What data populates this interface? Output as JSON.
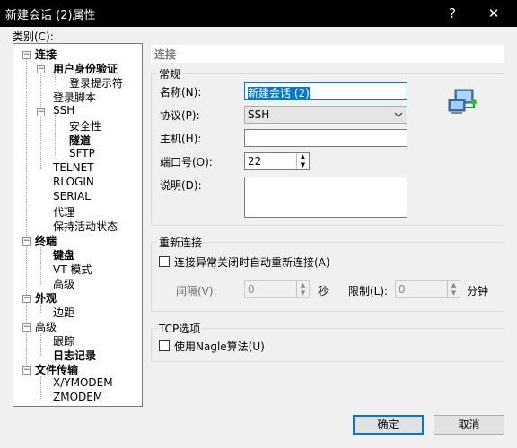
{
  "window": {
    "title": "新建会话 (2)属性",
    "help": "?",
    "close": "✕"
  },
  "category_label": "类别(C):",
  "tree": [
    {
      "label": "连接",
      "bold": true
    },
    {
      "label": "用户身份验证",
      "bold": true
    },
    {
      "label": "登录提示符"
    },
    {
      "label": "登录脚本"
    },
    {
      "label": "SSH"
    },
    {
      "label": "安全性"
    },
    {
      "label": "隧道",
      "bold": true
    },
    {
      "label": "SFTP"
    },
    {
      "label": "TELNET"
    },
    {
      "label": "RLOGIN"
    },
    {
      "label": "SERIAL"
    },
    {
      "label": "代理"
    },
    {
      "label": "保持活动状态"
    },
    {
      "label": "终端",
      "bold": true
    },
    {
      "label": "键盘",
      "bold": true
    },
    {
      "label": "VT 模式"
    },
    {
      "label": "高级"
    },
    {
      "label": "外观",
      "bold": true
    },
    {
      "label": "边距"
    },
    {
      "label": "高级"
    },
    {
      "label": "跟踪"
    },
    {
      "label": "日志记录",
      "bold": true
    },
    {
      "label": "文件传输",
      "bold": true
    },
    {
      "label": "X/YMODEM"
    },
    {
      "label": "ZMODEM"
    }
  ],
  "panel": {
    "header": "连接",
    "general": {
      "title": "常规",
      "name_label": "名称(N):",
      "name_value": "新建会话 (2)",
      "protocol_label": "协议(P):",
      "protocol_value": "SSH",
      "host_label": "主机(H):",
      "host_value": "",
      "port_label": "端口号(O):",
      "port_value": "22",
      "desc_label": "说明(D):",
      "desc_value": ""
    },
    "reconnect": {
      "title": "重新连接",
      "checkbox_label": "连接异常关闭时自动重新连接(A)",
      "interval_label": "间隔(V):",
      "interval_value": "0",
      "interval_unit": "秒",
      "limit_label": "限制(L):",
      "limit_value": "0",
      "limit_unit": "分钟"
    },
    "tcp": {
      "title": "TCP选项",
      "nagle_label": "使用Nagle算法(U)"
    }
  },
  "buttons": {
    "ok": "确定",
    "cancel": "取消"
  },
  "colors": {
    "accent": "#0078d7",
    "titlebar": "#000000",
    "dialog_bg": "#f0f0f0"
  }
}
